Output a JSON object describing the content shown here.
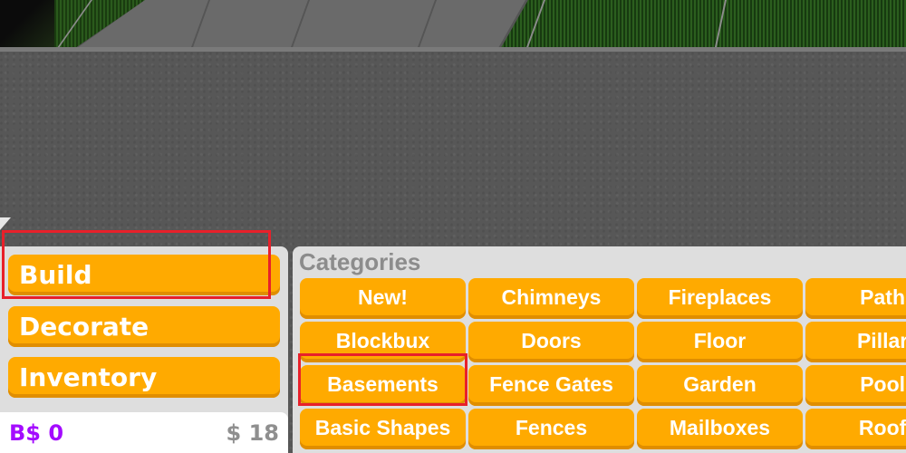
{
  "menu": {
    "items": [
      {
        "label": "Build"
      },
      {
        "label": "Decorate"
      },
      {
        "label": "Inventory"
      }
    ]
  },
  "wallet": {
    "blockbux": "B$ 0",
    "cash": "$ 18"
  },
  "categories": {
    "title": "Categories",
    "items": [
      "New!",
      "Chimneys",
      "Fireplaces",
      "Paths",
      "Blockbux",
      "Doors",
      "Floor",
      "Pillars",
      "Basements",
      "Fence Gates",
      "Garden",
      "Pools",
      "Basic Shapes",
      "Fences",
      "Mailboxes",
      "Roofs"
    ]
  },
  "highlights": [
    "Build",
    "Basements"
  ],
  "colors": {
    "button": "#ffaa00",
    "button_shadow": "#e08e00",
    "panel": "#dedede",
    "blockbux": "#a40bff",
    "cash": "#8f8f8f",
    "highlight": "#e8202a"
  }
}
